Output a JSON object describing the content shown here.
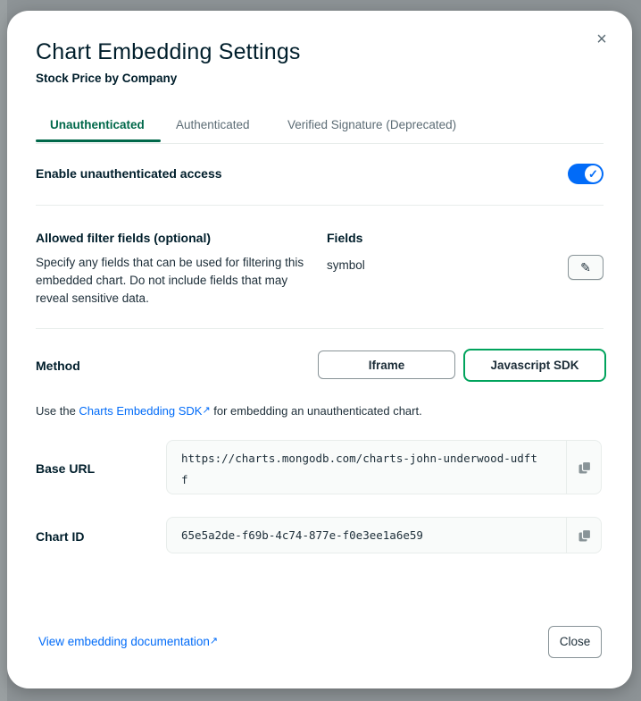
{
  "modal": {
    "title": "Chart Embedding Settings",
    "subtitle": "Stock Price by Company",
    "close_glyph": "×"
  },
  "tabs": [
    {
      "label": "Unauthenticated",
      "active": true
    },
    {
      "label": "Authenticated",
      "active": false
    },
    {
      "label": "Verified Signature (Deprecated)",
      "active": false
    }
  ],
  "access": {
    "label": "Enable unauthenticated access",
    "enabled": true
  },
  "filter": {
    "heading": "Allowed filter fields (optional)",
    "description": "Specify any fields that can be used for filtering this embedded chart. Do not include fields that may reveal sensitive data.",
    "fields_heading": "Fields",
    "fields_value": "symbol"
  },
  "method": {
    "label": "Method",
    "options": [
      "Iframe",
      "Javascript SDK"
    ],
    "selected": "Javascript SDK"
  },
  "sdk_note": {
    "prefix": "Use the ",
    "link_text": "Charts Embedding SDK",
    "suffix": " for embedding an unauthenticated chart."
  },
  "base_url": {
    "label": "Base URL",
    "value": "https://charts.mongodb.com/charts-john-underwood-udftf"
  },
  "chart_id": {
    "label": "Chart ID",
    "value": "65e5a2de-f69b-4c74-877e-f0e3ee1a6e59"
  },
  "footer": {
    "doc_link": "View embedding documentation",
    "close_label": "Close"
  },
  "icons": {
    "close": "close-icon",
    "check": "check-icon",
    "edit": "pencil-icon",
    "copy": "copy-icon",
    "external": "external-link-icon"
  },
  "colors": {
    "accent_green": "#00684a",
    "toggle_blue": "#016bf8",
    "link_blue": "#016bf8",
    "selected_border": "#00a35c"
  }
}
